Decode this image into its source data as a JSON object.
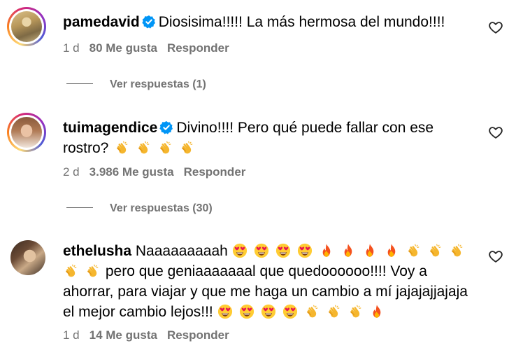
{
  "comments": [
    {
      "username": "pamedavid",
      "verified": true,
      "text": "Diosisima!!!!! La más hermosa del mundo!!!!",
      "time": "1 d",
      "likes": "80 Me gusta",
      "reply_label": "Responder",
      "view_replies": "Ver respuestas (1)"
    },
    {
      "username": "tuimagendice",
      "verified": true,
      "text": "Divino!!!! Pero qué puede fallar con ese rostro?",
      "emojis": [
        "clapping-hands",
        "clapping-hands",
        "clapping-hands",
        "clapping-hands"
      ],
      "time": "2 d",
      "likes": "3.986 Me gusta",
      "reply_label": "Responder",
      "view_replies": "Ver respuestas (30)"
    },
    {
      "username": "ethelusha",
      "verified": false,
      "text_1": "Naaaaaaaaah",
      "text_2": "pero que geniaaaaaaal que quedoooooo!!!! Voy a ahorrar, para viajar y que me haga un cambio a mí jajajajjajaja el mejor cambio lejos!!!",
      "emojis_1": [
        "heart-eyes",
        "heart-eyes",
        "heart-eyes",
        "heart-eyes",
        "fire",
        "fire",
        "fire",
        "fire",
        "clapping-hands",
        "clapping-hands",
        "clapping-hands",
        "clapping-hands",
        "clapping-hands"
      ],
      "emojis_2": [
        "heart-eyes",
        "heart-eyes",
        "heart-eyes",
        "heart-eyes",
        "clapping-hands",
        "clapping-hands",
        "clapping-hands",
        "fire"
      ],
      "time": "1 d",
      "likes": "14 Me gusta",
      "reply_label": "Responder"
    }
  ],
  "icons": {
    "like": "heart-outline-icon",
    "verified": "verified-badge-icon"
  },
  "colors": {
    "text": "#000000",
    "secondary": "#737373",
    "verified": "#0095f6"
  }
}
